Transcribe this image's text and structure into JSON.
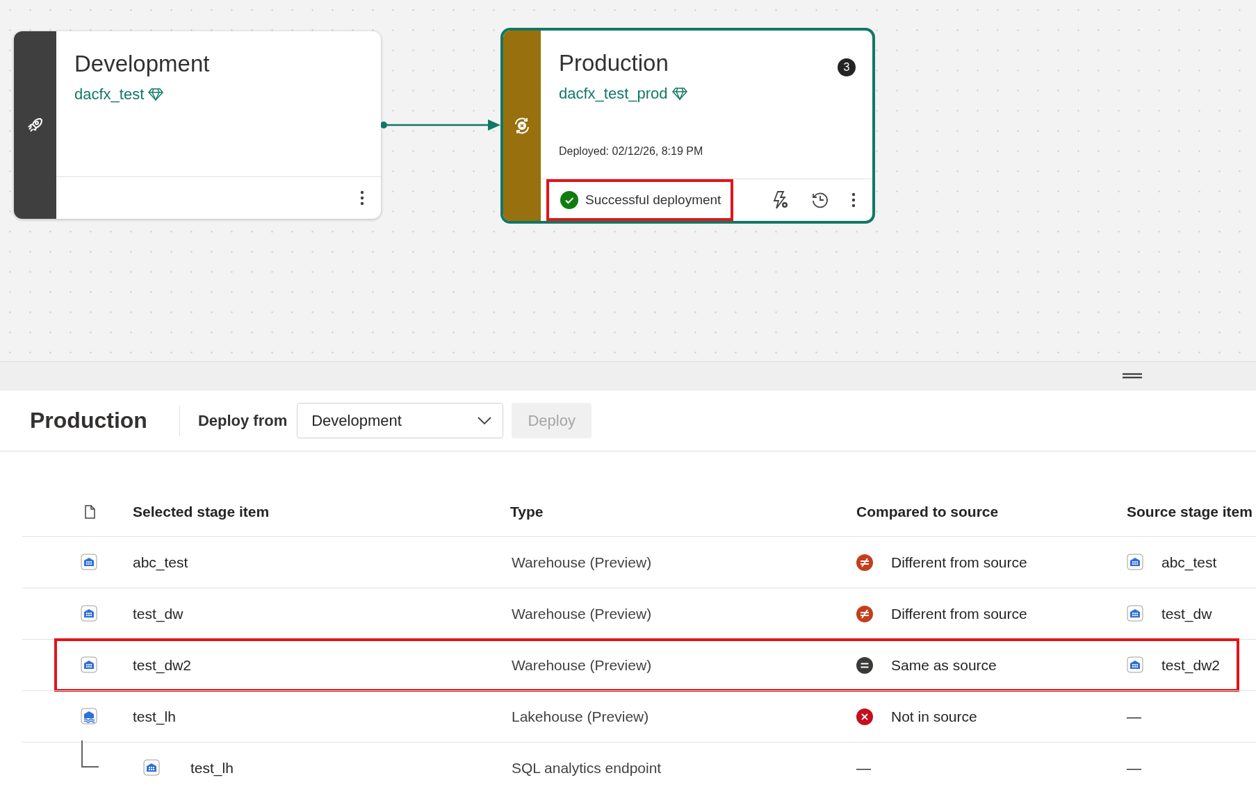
{
  "canvas": {
    "stages": [
      {
        "kind": "source",
        "title": "Development",
        "workspace": "dacfx_test",
        "color": "#3f3f3f",
        "selected": false
      },
      {
        "kind": "target",
        "title": "Production",
        "workspace": "dacfx_test_prod",
        "color": "#98700d",
        "selected": true,
        "badge": "3",
        "deployed": "Deployed: 02/12/26, 8:19 PM",
        "status": {
          "text": "Successful deployment",
          "highlighted": true
        }
      }
    ]
  },
  "panel": {
    "title": "Production",
    "deploy_from_label": "Deploy from",
    "deploy_from_value": "Development",
    "deploy_button": {
      "label": "Deploy",
      "disabled": true
    }
  },
  "table": {
    "columns": [
      "Selected stage item",
      "Type",
      "Compared to source",
      "Source stage item"
    ],
    "rows": [
      {
        "kind": "warehouse",
        "name": "abc_test",
        "type": "Warehouse (Preview)",
        "comparison": {
          "kind": "different",
          "text": "Different from source"
        },
        "source": {
          "kind": "warehouse",
          "text": "abc_test"
        },
        "highlighted": false
      },
      {
        "kind": "warehouse",
        "name": "test_dw",
        "type": "Warehouse (Preview)",
        "comparison": {
          "kind": "different",
          "text": "Different from source"
        },
        "source": {
          "kind": "warehouse",
          "text": "test_dw"
        },
        "highlighted": false
      },
      {
        "kind": "warehouse",
        "name": "test_dw2",
        "type": "Warehouse (Preview)",
        "comparison": {
          "kind": "same",
          "text": "Same as source"
        },
        "source": {
          "kind": "warehouse",
          "text": "test_dw2"
        },
        "highlighted": true
      },
      {
        "kind": "lakehouse",
        "name": "test_lh",
        "type": "Lakehouse (Preview)",
        "comparison": {
          "kind": "missing",
          "text": "Not in source"
        },
        "source": {
          "text": "—"
        },
        "highlighted": false,
        "children": [
          {
            "kind": "warehouse",
            "name": "test_lh",
            "type": "SQL analytics endpoint",
            "comparison": {
              "text": "—"
            },
            "source": {
              "text": "—"
            },
            "highlighted": false
          }
        ]
      }
    ]
  }
}
